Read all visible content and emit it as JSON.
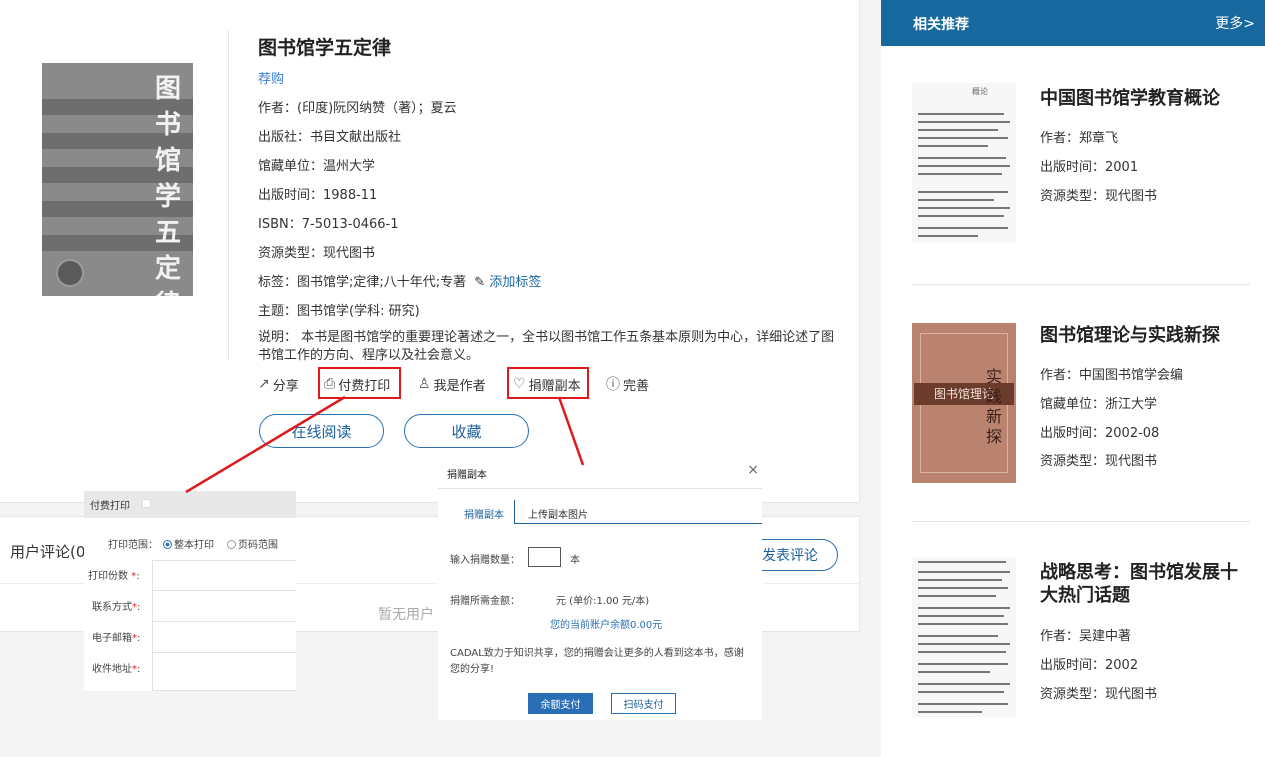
{
  "book": {
    "title": "图书馆学五定律",
    "recommend_link": "荐购",
    "author": "作者：(印度)阮冈纳赞（著）；夏云",
    "publisher": "出版社：书目文献出版社",
    "holding": "馆藏单位：温州大学",
    "pub_date": "出版时间：1988-11",
    "isbn": "ISBN：7-5013-0466-1",
    "resource_type": "资源类型：现代图书",
    "tags_label": "标签：图书馆学;定律;八十年代;专著",
    "add_tag": "添加标签",
    "subject": "主题：图书馆学(学科: 研究)",
    "description": "说明：  本书是图书馆学的重要理论著述之一，全书以图书馆工作五条基本原则为中心，详细论述了图书馆工作的方向、程序以及社会意义。",
    "cover_text": "图书馆学五定律"
  },
  "actions": {
    "share": "分享",
    "paid_print": "付费打印",
    "i_am_author": "我是作者",
    "donate_copy": "捐赠副本",
    "improve": "完善"
  },
  "buttons": {
    "read_online": "在线阅读",
    "favorite": "收藏"
  },
  "comments": {
    "title": "用户评论(0",
    "post": "发表评论",
    "empty": "暂无用户"
  },
  "sidebar": {
    "title": "相关推荐",
    "more": "更多>",
    "items": [
      {
        "title": "中国图书馆学教育概论",
        "meta1": "作者：郑章飞",
        "meta2": "出版时间：2001",
        "meta3": "资源类型：现代图书",
        "cover_text": "概论"
      },
      {
        "title": "图书馆理论与实践新探",
        "meta1": "作者：中国图书馆学会编",
        "meta2": "馆藏单位：浙江大学",
        "meta3": "出版时间：2002-08",
        "meta4": "资源类型：现代图书",
        "cover_text": "图书馆理论",
        "cover_text2": "实践新探"
      },
      {
        "title": "战略思考：图书馆发展十大热门话题",
        "meta1": "作者：吴建中著",
        "meta2": "出版时间：2002",
        "meta3": "资源类型：现代图书"
      }
    ]
  },
  "print_popup": {
    "title": "付费打印",
    "range_label": "打印范围：",
    "range_whole": "整本打印",
    "range_pages": "页码范围",
    "copies_label": "打印份数",
    "contact_label": "联系方式",
    "email_label": "电子邮箱",
    "address_label": "收件地址"
  },
  "donate_popup": {
    "title": "捐赠副本",
    "close": "×",
    "tab_donate": "捐赠副本",
    "tab_upload": "上传副本图片",
    "qty_label": "输入捐赠数量：",
    "qty_unit": "本",
    "amount_label": "捐赠所需金额：",
    "amount_value": "元 (单价:1.00 元/本)",
    "balance": "您的当前账户余额0.00元",
    "note": "CADAL致力于知识共享，您的捐赠会让更多的人看到这本书，感谢您的分享!",
    "balance_pay": "余额支付",
    "scan_pay": "扫码支付"
  },
  "colors": {
    "accent": "#16689e",
    "highlight": "#e0191c"
  }
}
